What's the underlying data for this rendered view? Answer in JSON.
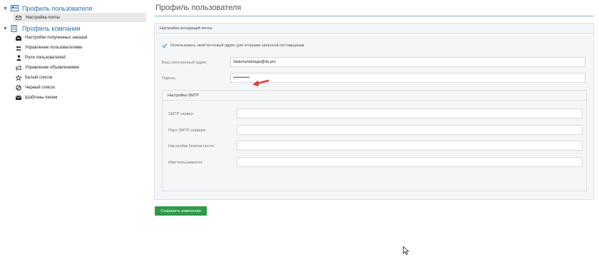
{
  "sidebar": {
    "user_profile": {
      "label": "Профиль пользователя",
      "children": [
        {
          "label": "Настройка почты",
          "icon": "envelope-outline-icon",
          "selected": true
        }
      ]
    },
    "company_profile": {
      "label": "Профиль компании",
      "children": [
        {
          "label": "Настройки полученных заказов",
          "icon": "tray-icon"
        },
        {
          "label": "Управление пользователями",
          "icon": "users-icon"
        },
        {
          "label": "Роли пользователей",
          "icon": "user-lock-icon"
        },
        {
          "label": "Управление объявлениями",
          "icon": "bullhorn-icon"
        },
        {
          "label": "Белый список",
          "icon": "star-outline-icon"
        },
        {
          "label": "Черный список",
          "icon": "ban-icon"
        },
        {
          "label": "Шаблоны писем",
          "icon": "envelope-solid-icon"
        }
      ]
    }
  },
  "main": {
    "page_title": "Профиль пользователя",
    "outgoing_panel": {
      "title": "Настройка исходящей почты",
      "use_own_email_label": "Использовать свой почтовый адрес для отправки запросов поставщикам",
      "use_own_email_checked": true,
      "email_label": "Ваш электронный адрес",
      "email_value": "SistemaVertago@vb.pro",
      "password_label": "Пароль",
      "password_value": "••••••••••••"
    },
    "smtp_panel": {
      "title": "Настройка SMTP",
      "server_label": "SMTP сервер:",
      "server_value": "",
      "port_label": "Порт SMTP сервера:",
      "port_value": "",
      "security_label": "Настройки безопасности:",
      "security_value": "",
      "username_label": "Имя пользователя:",
      "username_value": ""
    },
    "save_button_label": "Сохранить изменения"
  },
  "colors": {
    "link_blue": "#2a6fb5",
    "save_green": "#2e9a4a",
    "arrow_red": "#e0403a",
    "rule_blue": "#7fb3d5"
  }
}
